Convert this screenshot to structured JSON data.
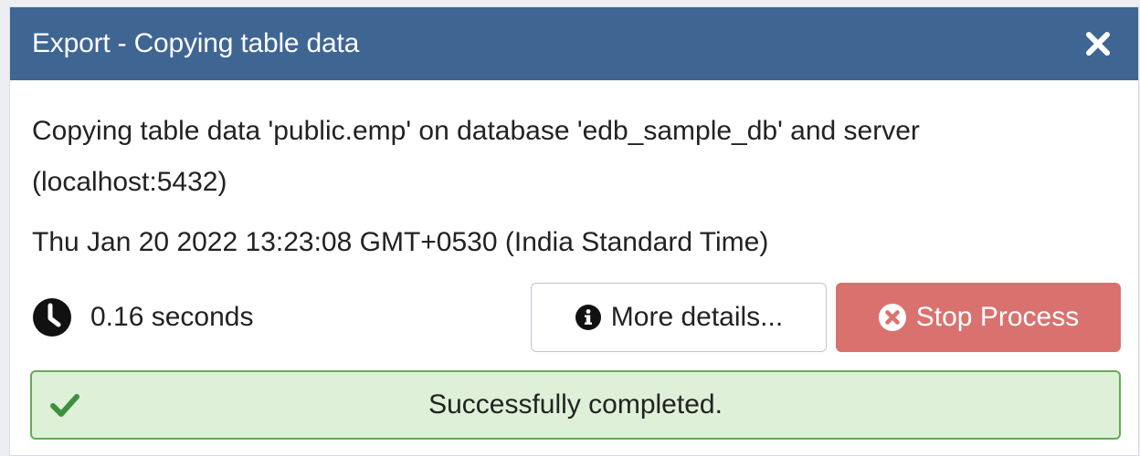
{
  "dialog": {
    "title": "Export - Copying table data",
    "close_icon": "close-icon"
  },
  "body": {
    "message": "Copying table data 'public.emp' on database 'edb_sample_db' and server (localhost:5432)",
    "timestamp": "Thu Jan 20 2022 13:23:08 GMT+0530 (India Standard Time)",
    "duration": "0.16 seconds",
    "duration_icon": "clock-icon"
  },
  "buttons": {
    "details_label": "More details...",
    "details_icon": "info-icon",
    "stop_label": "Stop Process",
    "stop_icon": "times-circle-icon"
  },
  "status": {
    "text": "Successfully completed.",
    "icon": "check-icon"
  },
  "colors": {
    "header": "#3f6593",
    "stop_button": "#d9726f",
    "success_bg": "#dff0d8",
    "success_border": "#67a95a",
    "success_check": "#3e8f3e"
  }
}
